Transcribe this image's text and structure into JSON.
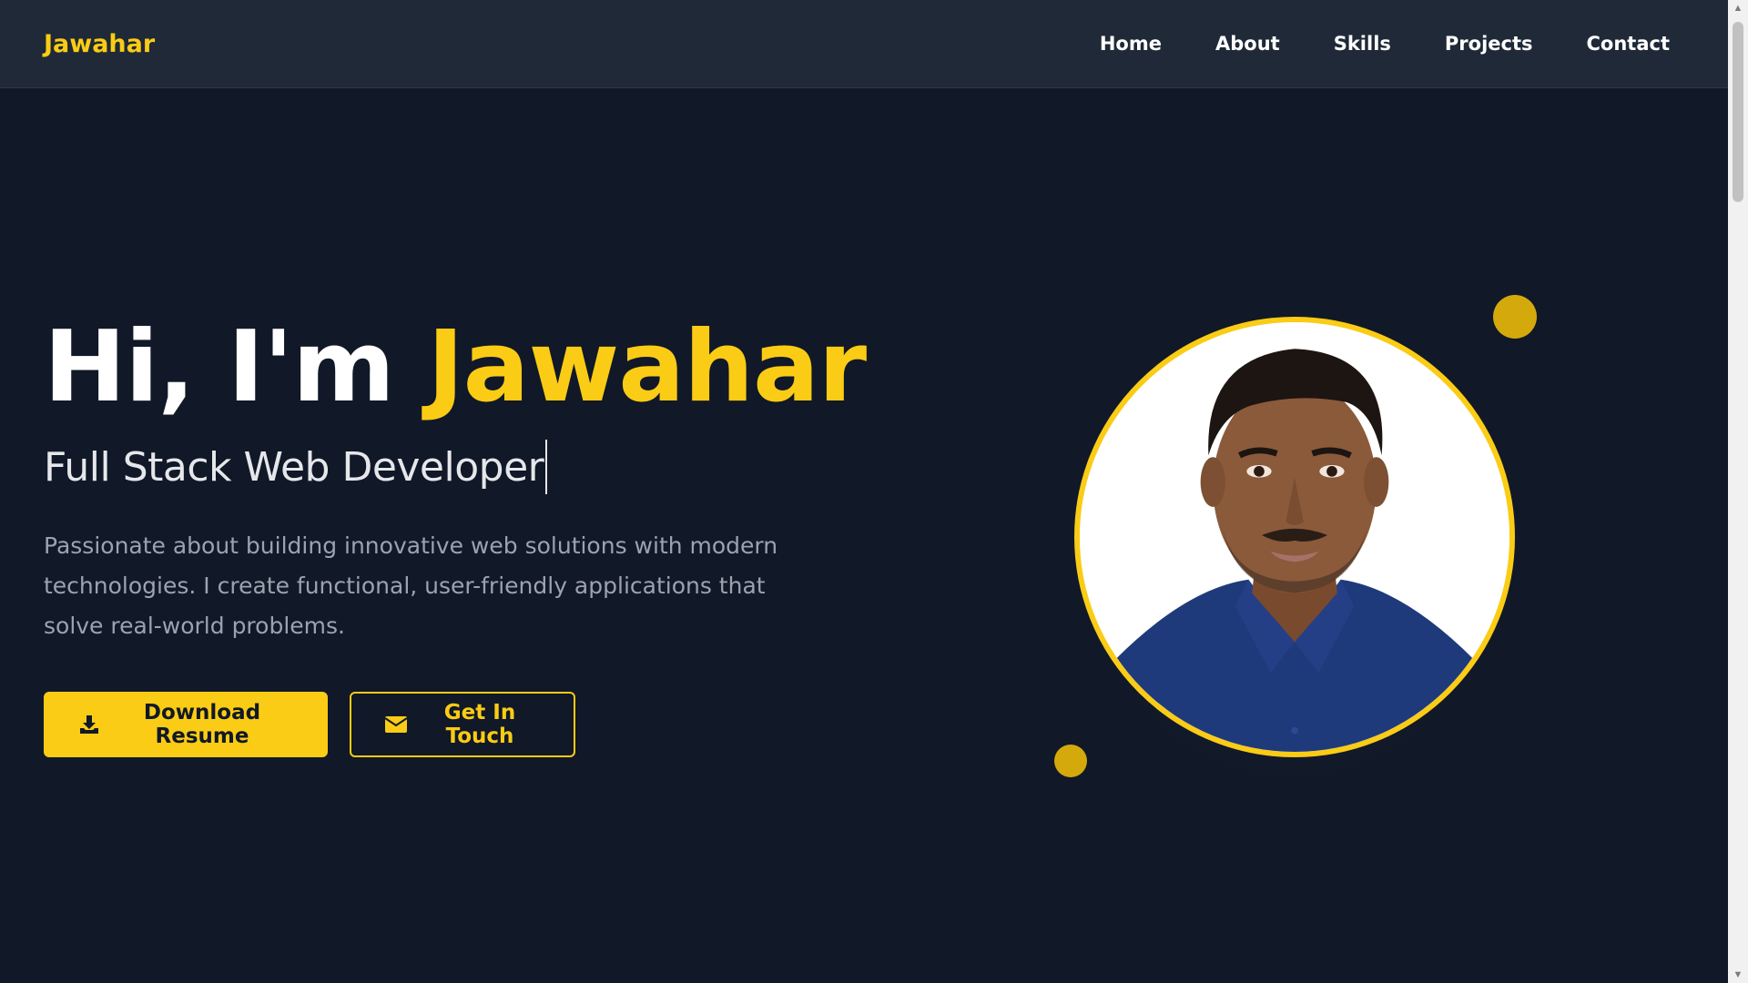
{
  "nav": {
    "brand": "Jawahar",
    "links": [
      "Home",
      "About",
      "Skills",
      "Projects",
      "Contact"
    ]
  },
  "hero": {
    "greeting": "Hi, I'm ",
    "name": "Jawahar",
    "subtitle": "Full Stack Web Developer",
    "description": "Passionate about building innovative web solutions with modern technologies. I create functional, user-friendly applications that solve real-world problems.",
    "primary_button": "Download Resume",
    "secondary_button": "Get In Touch",
    "primary_icon": "download-icon",
    "secondary_icon": "envelope-icon"
  },
  "colors": {
    "background": "#111827",
    "navbar": "#1f2937",
    "accent": "#facc15",
    "text_muted": "#9ca3af"
  }
}
